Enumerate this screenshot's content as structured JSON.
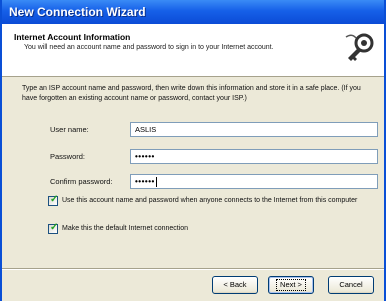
{
  "window": {
    "title": "New Connection Wizard"
  },
  "header": {
    "title": "Internet Account Information",
    "subtitle": "You will need an account name and password to sign in to your Internet account.",
    "icon": "key-icon"
  },
  "instructions": "Type an ISP account name and password, then write down this information and store it in a safe place. (If you have forgotten an existing account name or password, contact your ISP.)",
  "fields": {
    "username": {
      "label": "User name:",
      "value": "ASLIS"
    },
    "password": {
      "label": "Password:",
      "value": "••••••"
    },
    "confirm": {
      "label": "Confirm password:",
      "value": "••••••"
    }
  },
  "checkboxes": [
    {
      "label": "Use this account name and password when anyone connects to the Internet from this computer",
      "checked": true
    },
    {
      "label": "Make this the default Internet connection",
      "checked": true
    }
  ],
  "buttons": {
    "back": "< Back",
    "next": "Next >",
    "cancel": "Cancel"
  }
}
